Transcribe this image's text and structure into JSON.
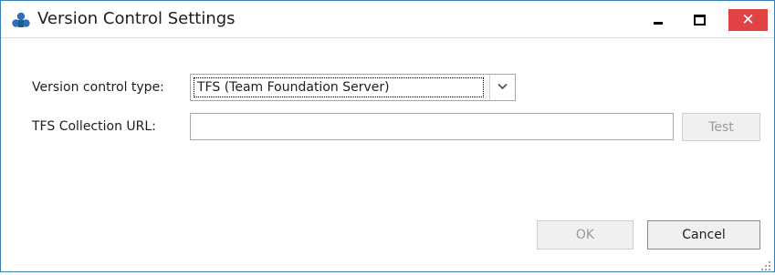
{
  "window": {
    "title": "Version Control Settings",
    "app_icon": "version-control-app-icon",
    "controls": {
      "minimize": "minimize-icon",
      "maximize": "maximize-icon",
      "close": "close-icon"
    },
    "colors": {
      "border": "#3c7fb1",
      "close_bg": "#e04343",
      "icon_blue": "#2f6fb3"
    }
  },
  "form": {
    "version_control_type": {
      "label": "Version control type:",
      "selected": "TFS (Team Foundation Server)",
      "icon": "chevron-down-icon"
    },
    "collection_url": {
      "label": "TFS Collection URL:",
      "value": "",
      "placeholder": ""
    },
    "test_label": "Test"
  },
  "footer": {
    "ok_label": "OK",
    "cancel_label": "Cancel",
    "resize_grip": "resize-grip-icon"
  }
}
